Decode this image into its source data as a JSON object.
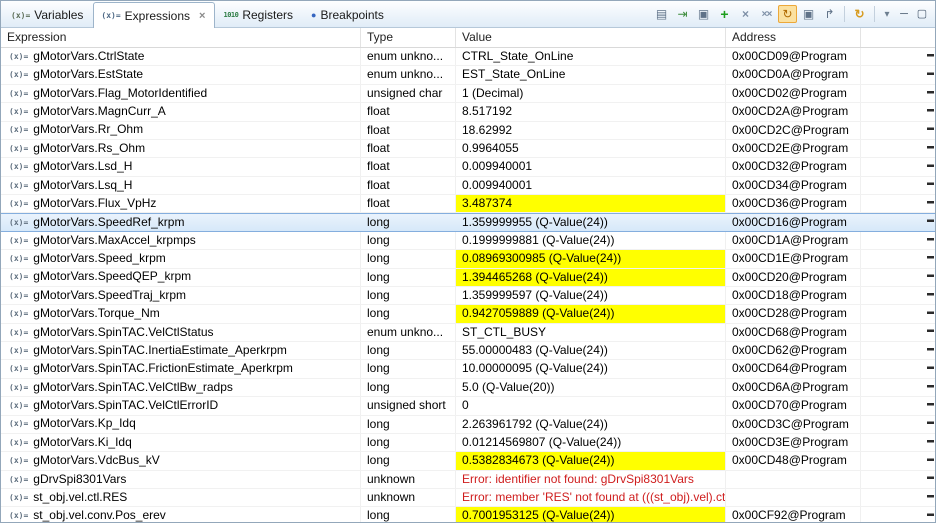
{
  "tabs": [
    {
      "label": "Variables",
      "icon": "variables-icon",
      "icon_glyph": "(x)="
    },
    {
      "label": "Expressions",
      "icon": "expressions-icon",
      "icon_glyph": "(x)=",
      "active": true,
      "closable": true,
      "close_glyph": "×"
    },
    {
      "label": "Registers",
      "icon": "registers-icon",
      "icon_glyph": "1010"
    },
    {
      "label": "Breakpoints",
      "icon": "breakpoints-icon",
      "icon_glyph": "●"
    }
  ],
  "toolbar": {
    "items": [
      {
        "name": "layout-icon",
        "glyph": "▤"
      },
      {
        "name": "import-expressions-icon",
        "glyph": "⇥"
      },
      {
        "name": "new-view-icon",
        "glyph": "▣"
      },
      {
        "name": "add-expression-icon",
        "glyph": "+"
      },
      {
        "name": "remove-expression-icon",
        "glyph": "×"
      },
      {
        "name": "remove-all-expressions-icon",
        "glyph": "××"
      },
      {
        "name": "continuous-refresh-icon",
        "glyph": "↻",
        "active": true
      },
      {
        "name": "copy-expressions-icon",
        "glyph": "▣"
      },
      {
        "name": "export-expressions-icon",
        "glyph": "↱"
      },
      {
        "divider": true
      },
      {
        "name": "refresh-icon",
        "glyph": "↻"
      },
      {
        "divider": true
      },
      {
        "name": "view-menu-icon",
        "glyph": "▾"
      },
      {
        "name": "minimize-icon",
        "glyph": "─"
      },
      {
        "name": "maximize-icon",
        "glyph": "▢"
      }
    ]
  },
  "table": {
    "columns": [
      "Expression",
      "Type",
      "Value",
      "Address"
    ],
    "row_icon_glyph": "(x)=",
    "highlight_color": "#ffff00",
    "selection_color": "#d6e8f9",
    "error_color": "#cf1d1d",
    "rows": [
      {
        "expression": "gMotorVars.CtrlState",
        "type": "enum unkno...",
        "value": "CTRL_State_OnLine",
        "address": "0x00CD09@Program"
      },
      {
        "expression": "gMotorVars.EstState",
        "type": "enum unkno...",
        "value": "EST_State_OnLine",
        "address": "0x00CD0A@Program"
      },
      {
        "expression": "gMotorVars.Flag_MotorIdentified",
        "type": "unsigned char",
        "value": "1 (Decimal)",
        "address": "0x00CD02@Program"
      },
      {
        "expression": "gMotorVars.MagnCurr_A",
        "type": "float",
        "value": "8.517192",
        "address": "0x00CD2A@Program"
      },
      {
        "expression": "gMotorVars.Rr_Ohm",
        "type": "float",
        "value": "18.62992",
        "address": "0x00CD2C@Program"
      },
      {
        "expression": "gMotorVars.Rs_Ohm",
        "type": "float",
        "value": "0.9964055",
        "address": "0x00CD2E@Program"
      },
      {
        "expression": "gMotorVars.Lsd_H",
        "type": "float",
        "value": "0.009940001",
        "address": "0x00CD32@Program"
      },
      {
        "expression": "gMotorVars.Lsq_H",
        "type": "float",
        "value": "0.009940001",
        "address": "0x00CD34@Program"
      },
      {
        "expression": "gMotorVars.Flux_VpHz",
        "type": "float",
        "value": "3.487374",
        "address": "0x00CD36@Program",
        "changed": true
      },
      {
        "expression": "gMotorVars.SpeedRef_krpm",
        "type": "long",
        "value": "1.359999955 (Q-Value(24))",
        "address": "0x00CD16@Program",
        "selected": true
      },
      {
        "expression": "gMotorVars.MaxAccel_krpmps",
        "type": "long",
        "value": "0.1999999881 (Q-Value(24))",
        "address": "0x00CD1A@Program"
      },
      {
        "expression": "gMotorVars.Speed_krpm",
        "type": "long",
        "value": "0.08969300985 (Q-Value(24))",
        "address": "0x00CD1E@Program",
        "changed": true
      },
      {
        "expression": "gMotorVars.SpeedQEP_krpm",
        "type": "long",
        "value": "1.394465268 (Q-Value(24))",
        "address": "0x00CD20@Program",
        "changed": true
      },
      {
        "expression": "gMotorVars.SpeedTraj_krpm",
        "type": "long",
        "value": "1.359999597 (Q-Value(24))",
        "address": "0x00CD18@Program"
      },
      {
        "expression": "gMotorVars.Torque_Nm",
        "type": "long",
        "value": "0.9427059889 (Q-Value(24))",
        "address": "0x00CD28@Program",
        "changed": true
      },
      {
        "expression": "gMotorVars.SpinTAC.VelCtlStatus",
        "type": "enum unkno...",
        "value": "ST_CTL_BUSY",
        "address": "0x00CD68@Program"
      },
      {
        "expression": "gMotorVars.SpinTAC.InertiaEstimate_Aperkrpm",
        "type": "long",
        "value": "55.00000483 (Q-Value(24))",
        "address": "0x00CD62@Program"
      },
      {
        "expression": "gMotorVars.SpinTAC.FrictionEstimate_Aperkrpm",
        "type": "long",
        "value": "10.00000095 (Q-Value(24))",
        "address": "0x00CD64@Program"
      },
      {
        "expression": "gMotorVars.SpinTAC.VelCtlBw_radps",
        "type": "long",
        "value": "5.0 (Q-Value(20))",
        "address": "0x00CD6A@Program"
      },
      {
        "expression": "gMotorVars.SpinTAC.VelCtlErrorID",
        "type": "unsigned short",
        "value": "0",
        "address": "0x00CD70@Program"
      },
      {
        "expression": "gMotorVars.Kp_Idq",
        "type": "long",
        "value": "2.263961792 (Q-Value(24))",
        "address": "0x00CD3C@Program"
      },
      {
        "expression": "gMotorVars.Ki_Idq",
        "type": "long",
        "value": "0.01214569807 (Q-Value(24))",
        "address": "0x00CD3E@Program"
      },
      {
        "expression": "gMotorVars.VdcBus_kV",
        "type": "long",
        "value": "0.5382834673 (Q-Value(24))",
        "address": "0x00CD48@Program",
        "changed": true
      },
      {
        "expression": "gDrvSpi8301Vars",
        "type": "unknown",
        "value": "Error: identifier not found: gDrvSpi8301Vars",
        "address": "",
        "error": true
      },
      {
        "expression": "st_obj.vel.ctl.RES",
        "type": "unknown",
        "value": "Error: member 'RES' not found at (((st_obj).vel).ctl...",
        "address": "",
        "error": true
      },
      {
        "expression": "st_obj.vel.conv.Pos_erev",
        "type": "long",
        "value": "0.7001953125 (Q-Value(24))",
        "address": "0x00CF92@Program",
        "changed": true
      }
    ]
  }
}
